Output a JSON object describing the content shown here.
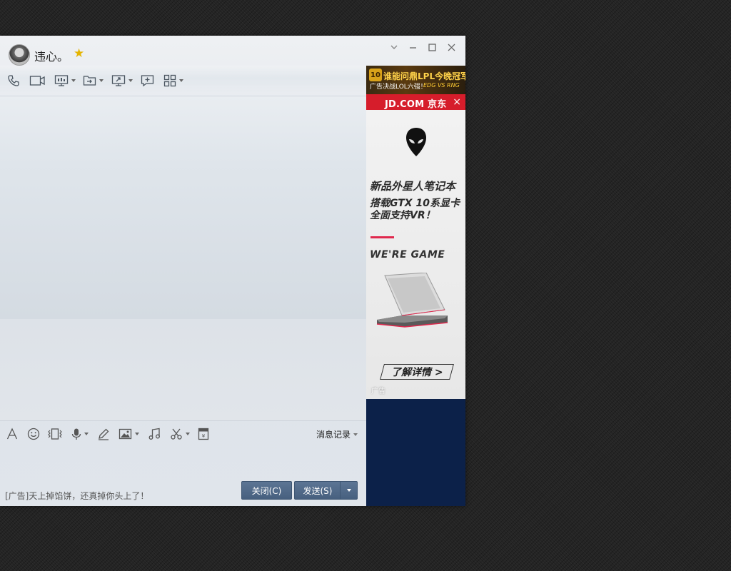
{
  "window": {
    "contact_name": "违心。",
    "star_glyph": "★"
  },
  "toolbar": {
    "icons": [
      "phone-icon",
      "video-icon",
      "screen-share-icon",
      "file-transfer-icon",
      "remote-desktop-icon",
      "create-group-icon",
      "apps-icon"
    ]
  },
  "input_toolbar": {
    "history_label": "消息记录"
  },
  "footer": {
    "ad_text": "[广告]天上掉馅饼，还真掉你头上了！",
    "close_label": "关闭(C)",
    "send_label": "发送(S)"
  },
  "side_ad": {
    "top_banner_title": "谁能问鼎LPL今晚冠军",
    "top_banner_sub": "广告决战LOL六强！",
    "top_banner_match": "EDG VS RNG",
    "top_banner_badge": "10",
    "jd_text": "JD.COM 京东",
    "jd_close": "×",
    "headline": "新品外星人笔记本",
    "line1": "搭载GTX 10系显卡",
    "line2": "全面支持VR！",
    "slogan": "WE'RE GAME",
    "more_label": "了解详情 >",
    "ad_label": "广告"
  },
  "colors": {
    "jd_red": "#d61d2b",
    "button_blue": "#4f6888",
    "ad_navy": "#0c2149",
    "accent_pink": "#e0284d"
  }
}
